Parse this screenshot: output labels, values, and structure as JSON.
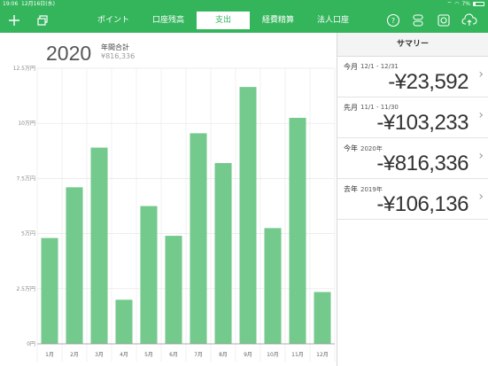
{
  "status_bar": {
    "time": "19:06",
    "date": "12月16日(水)",
    "battery": "7%"
  },
  "nav": {
    "add_icon": "plus-icon",
    "copy_icon": "copy-icon",
    "tabs": [
      {
        "label": "ポイント",
        "active": false
      },
      {
        "label": "口座残高",
        "active": false
      },
      {
        "label": "支出",
        "active": true
      },
      {
        "label": "経費精算",
        "active": false
      },
      {
        "label": "法人口座",
        "active": false
      }
    ],
    "right_icons": [
      "help-icon",
      "toggle-icon",
      "settings-icon",
      "cloud-upload-icon"
    ],
    "accent_color": "#34b55c"
  },
  "chart_header": {
    "year": "2020",
    "annual_label": "年間合計",
    "annual_value": "¥816,336"
  },
  "chart_data": {
    "type": "bar",
    "categories": [
      "1月",
      "2月",
      "3月",
      "4月",
      "5月",
      "6月",
      "7月",
      "8月",
      "9月",
      "10月",
      "11月",
      "12月"
    ],
    "values": [
      48000,
      71000,
      89000,
      20000,
      62500,
      49000,
      95500,
      82000,
      116500,
      52500,
      102500,
      23500
    ],
    "ytick_labels": [
      "0円",
      "2.5万円",
      "5万円",
      "7.5万円",
      "10万円",
      "12.5万円"
    ],
    "ylim": [
      0,
      125000
    ],
    "bar_color": "#74c98c",
    "grid": true
  },
  "summary": {
    "title": "サマリー",
    "rows": [
      {
        "label": "今月",
        "range": "12/1 - 12/31",
        "value": "-¥23,592"
      },
      {
        "label": "先月",
        "range": "11/1 - 11/30",
        "value": "-¥103,233"
      },
      {
        "label": "今年",
        "range": "2020年",
        "value": "-¥816,336"
      },
      {
        "label": "去年",
        "range": "2019年",
        "value": "-¥106,136"
      }
    ]
  }
}
